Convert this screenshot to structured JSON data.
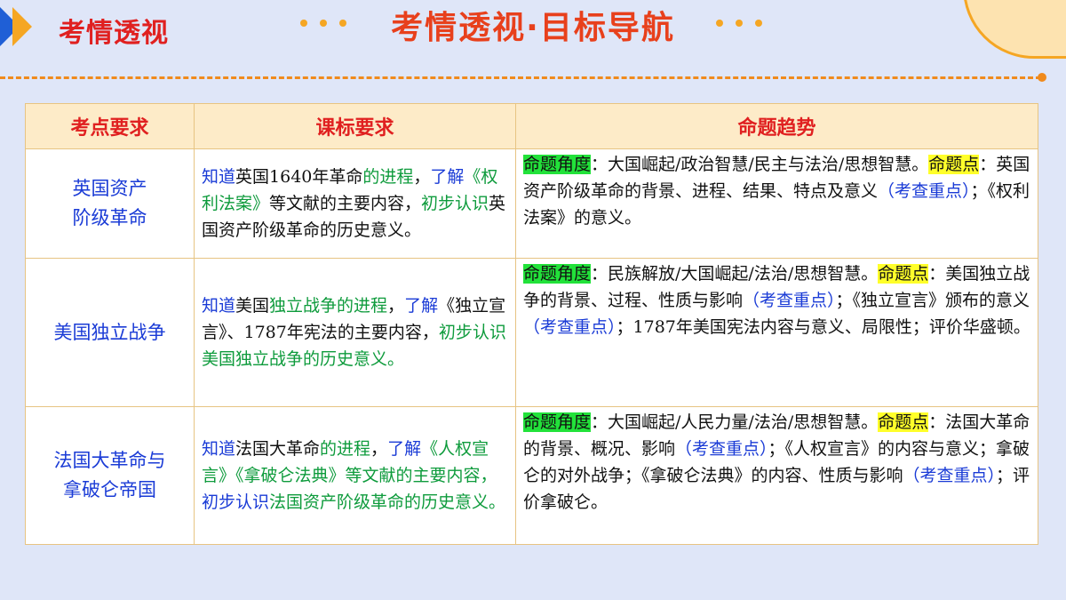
{
  "header": {
    "section_tag": "考情透视",
    "main_title": "考情透视·目标导航"
  },
  "table": {
    "columns": [
      "考点要求",
      "课标要求",
      "命题趋势"
    ],
    "rows": [
      {
        "topic": [
          "英国资产",
          "阶级革命"
        ],
        "requirement": [
          {
            "t": "知道",
            "c": "blue"
          },
          {
            "t": "英国1640年革命",
            "c": "black"
          },
          {
            "t": "的进程",
            "c": "green"
          },
          {
            "t": "，",
            "c": "black"
          },
          {
            "t": "了解",
            "c": "blue"
          },
          {
            "t": "《权利法案》",
            "c": "green"
          },
          {
            "t": "等文献的主要内容，",
            "c": "black"
          },
          {
            "t": "初步认识",
            "c": "green"
          },
          {
            "t": "英国资产阶级革命的历史意义。",
            "c": "black"
          }
        ],
        "trend": [
          {
            "t": "命题角度",
            "c": "hl-green"
          },
          {
            "t": "：大国崛起/政治智慧/民主与法治/思想智慧。",
            "c": "black"
          },
          {
            "t": "命题点",
            "c": "hl-yellow"
          },
          {
            "t": "：英国资产阶级革命的背景、进程、结果、特点及意义",
            "c": "black"
          },
          {
            "t": "（考查重点）",
            "c": "key"
          },
          {
            "t": "；《权利法案》的意义。",
            "c": "black"
          }
        ]
      },
      {
        "topic": [
          "美国独立战争"
        ],
        "requirement": [
          {
            "t": "知道",
            "c": "blue"
          },
          {
            "t": "美国",
            "c": "black"
          },
          {
            "t": "独立战争的进程",
            "c": "green"
          },
          {
            "t": "，",
            "c": "black"
          },
          {
            "t": "了解",
            "c": "blue"
          },
          {
            "t": "《独立宣言》、1787年宪法的主要内容，",
            "c": "black"
          },
          {
            "t": "初步认识",
            "c": "green"
          },
          {
            "t": "美国独立战争的历史意义。",
            "c": "green"
          }
        ],
        "trend": [
          {
            "t": "命题角度",
            "c": "hl-green"
          },
          {
            "t": "：民族解放/大国崛起/法治/思想智慧。",
            "c": "black"
          },
          {
            "t": "命题点",
            "c": "hl-yellow"
          },
          {
            "t": "：美国独立战争的背景、过程、性质与影响",
            "c": "black"
          },
          {
            "t": "（考查重点）",
            "c": "key"
          },
          {
            "t": "；《独立宣言》颁布的意义",
            "c": "black"
          },
          {
            "t": "（考查重点）",
            "c": "key"
          },
          {
            "t": "；1787年美国宪法内容与意义、局限性；评价华盛顿。",
            "c": "black"
          }
        ]
      },
      {
        "topic": [
          "法国大革命与",
          "拿破仑帝国"
        ],
        "requirement": [
          {
            "t": "知道",
            "c": "blue"
          },
          {
            "t": "法国大革命",
            "c": "black"
          },
          {
            "t": "的进程",
            "c": "green"
          },
          {
            "t": "，",
            "c": "black"
          },
          {
            "t": "了解",
            "c": "blue"
          },
          {
            "t": "《人权宣言》《拿破仑法典》",
            "c": "green"
          },
          {
            "t": "等文献的主要内容，",
            "c": "green"
          },
          {
            "t": "初步认识",
            "c": "blue"
          },
          {
            "t": "法国资产阶级革命的历史意义。",
            "c": "green"
          }
        ],
        "trend": [
          {
            "t": "命题角度",
            "c": "hl-green"
          },
          {
            "t": "：大国崛起/人民力量/法治/思想智慧。",
            "c": "black"
          },
          {
            "t": "命题点",
            "c": "hl-yellow"
          },
          {
            "t": "：法国大革命的背景、概况、影响",
            "c": "black"
          },
          {
            "t": "（考查重点）",
            "c": "key"
          },
          {
            "t": "；《人权宣言》的内容与意义；拿破仑的对外战争；《拿破仑法典》的内容、性质与影响",
            "c": "black"
          },
          {
            "t": "（考查重点）",
            "c": "key"
          },
          {
            "t": "；评价拿破仑。",
            "c": "black"
          }
        ]
      }
    ]
  }
}
